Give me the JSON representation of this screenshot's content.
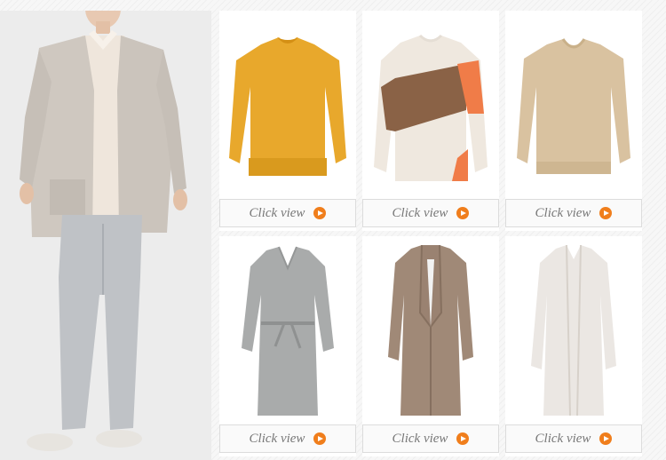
{
  "hero": {
    "image": "model-wearing-cardigan"
  },
  "colors": {
    "accent": "#f07e1c",
    "button_text": "#777777"
  },
  "products": [
    {
      "image": "mustard-sweater",
      "button_label": "Click view",
      "icon": "play-circle-icon"
    },
    {
      "image": "colorblock-sweater",
      "button_label": "Click view",
      "icon": "play-circle-icon"
    },
    {
      "image": "beige-sweater",
      "button_label": "Click view",
      "icon": "play-circle-icon"
    },
    {
      "image": "grey-knit-dress",
      "button_label": "Click view",
      "icon": "play-circle-icon"
    },
    {
      "image": "taupe-long-coat",
      "button_label": "Click view",
      "icon": "play-circle-icon"
    },
    {
      "image": "white-long-cardigan",
      "button_label": "Click view",
      "icon": "play-circle-icon"
    }
  ]
}
